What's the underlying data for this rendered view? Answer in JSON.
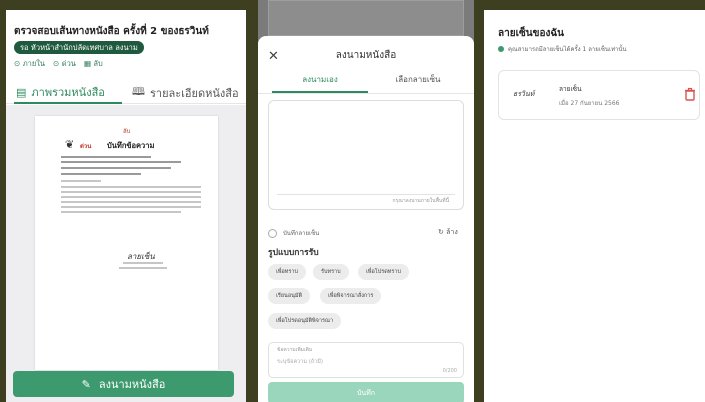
{
  "panel1": {
    "title": "ตรวจสอบเส้นทางหนังสือ ครั้งที่ 2 ของธรวินท์",
    "org_badge": "รอ หัวหน้าสำนักปลัดเทศบาล ลงนาม",
    "tags": [
      {
        "icon": "clock-icon",
        "label": "ภายใน"
      },
      {
        "icon": "clock-icon",
        "label": "ด่วน"
      },
      {
        "icon": "calendar-icon",
        "label": "ลับ"
      }
    ],
    "tabs": {
      "overview": "ภาพรวมหนังสือ",
      "details": "รายละเอียดหนังสือ"
    },
    "document": {
      "secret_mark": "ลับ",
      "urgent_mark": "ด่วน",
      "heading": "บันทึกข้อความ",
      "signature": "ลายเซ็น"
    },
    "sign_button": "ลงนามหนังสือ"
  },
  "panel2": {
    "title": "ลงนามหนังสือ",
    "tabs": {
      "sign_self": "ลงนามเอง",
      "choose_signature": "เลือกลายเซ็น"
    },
    "pad_hint": "กรุณาลงนามภายในพื้นที่นี้",
    "save_signature": "บันทึกลายเซ็น",
    "clear": "ล้าง",
    "section_title": "รูปแบบการรับ",
    "chips": [
      "เพื่อทราบ",
      "รับทราบ",
      "เพื่อโปรดทราบ",
      "เรียนอนุมัติ",
      "เพื่อพิจารณาสั่งการ",
      "เพื่อโปรดอนุมัติพิจารณา"
    ],
    "note_label": "ข้อความเพิ่มเติม",
    "note_placeholder": "ระบุข้อความ (ถ้ามี)",
    "note_count": "0/200",
    "submit": "บันทึก"
  },
  "panel3": {
    "title": "ลายเซ็นของฉัน",
    "subtitle": "คุณสามารถมีลายเซ็นได้ครั้ง 1 ลายเซ็นเท่านั้น",
    "signature_card": {
      "image_text": "ธรวินท์",
      "name": "ลายเซ็น",
      "date": "เมื่อ 27 กันยายน 2566"
    }
  },
  "colors": {
    "primary": "#2e8b5e",
    "button": "#3d9a6f",
    "badge": "#1f5a3e",
    "danger": "#d9534f",
    "submit_disabled": "#9ad6bb"
  }
}
